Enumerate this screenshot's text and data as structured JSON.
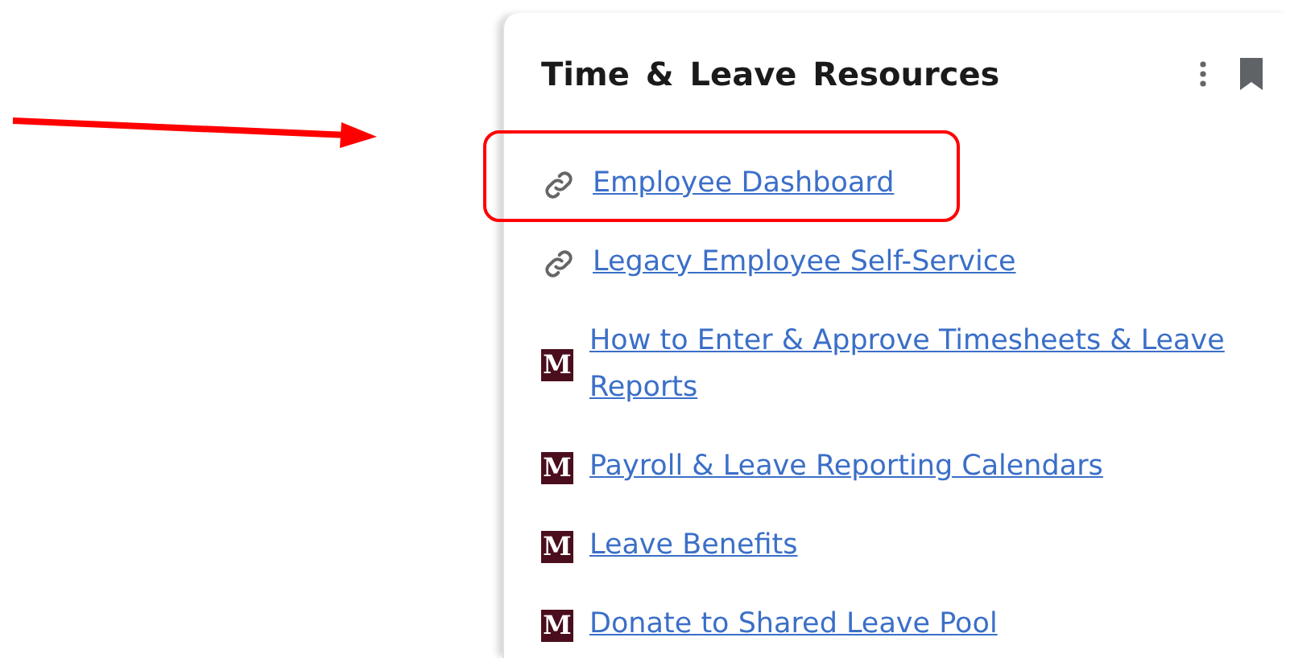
{
  "card": {
    "title": "Time & Leave Resources"
  },
  "links": [
    {
      "kind": "link",
      "label": "Employee Dashboard",
      "highlighted": true
    },
    {
      "kind": "link",
      "label": "Legacy Employee Self-Service",
      "highlighted": false
    },
    {
      "kind": "logo",
      "logo_letter": "M",
      "label": "How to Enter & Approve Timesheets & Leave Reports",
      "highlighted": false
    },
    {
      "kind": "logo",
      "logo_letter": "M",
      "label": "Payroll & Leave Reporting Calendars",
      "highlighted": false
    },
    {
      "kind": "logo",
      "logo_letter": "M",
      "label": "Leave Benefits",
      "highlighted": false
    },
    {
      "kind": "logo",
      "logo_letter": "M",
      "label": "Donate to Shared Leave Pool",
      "highlighted": false
    }
  ]
}
